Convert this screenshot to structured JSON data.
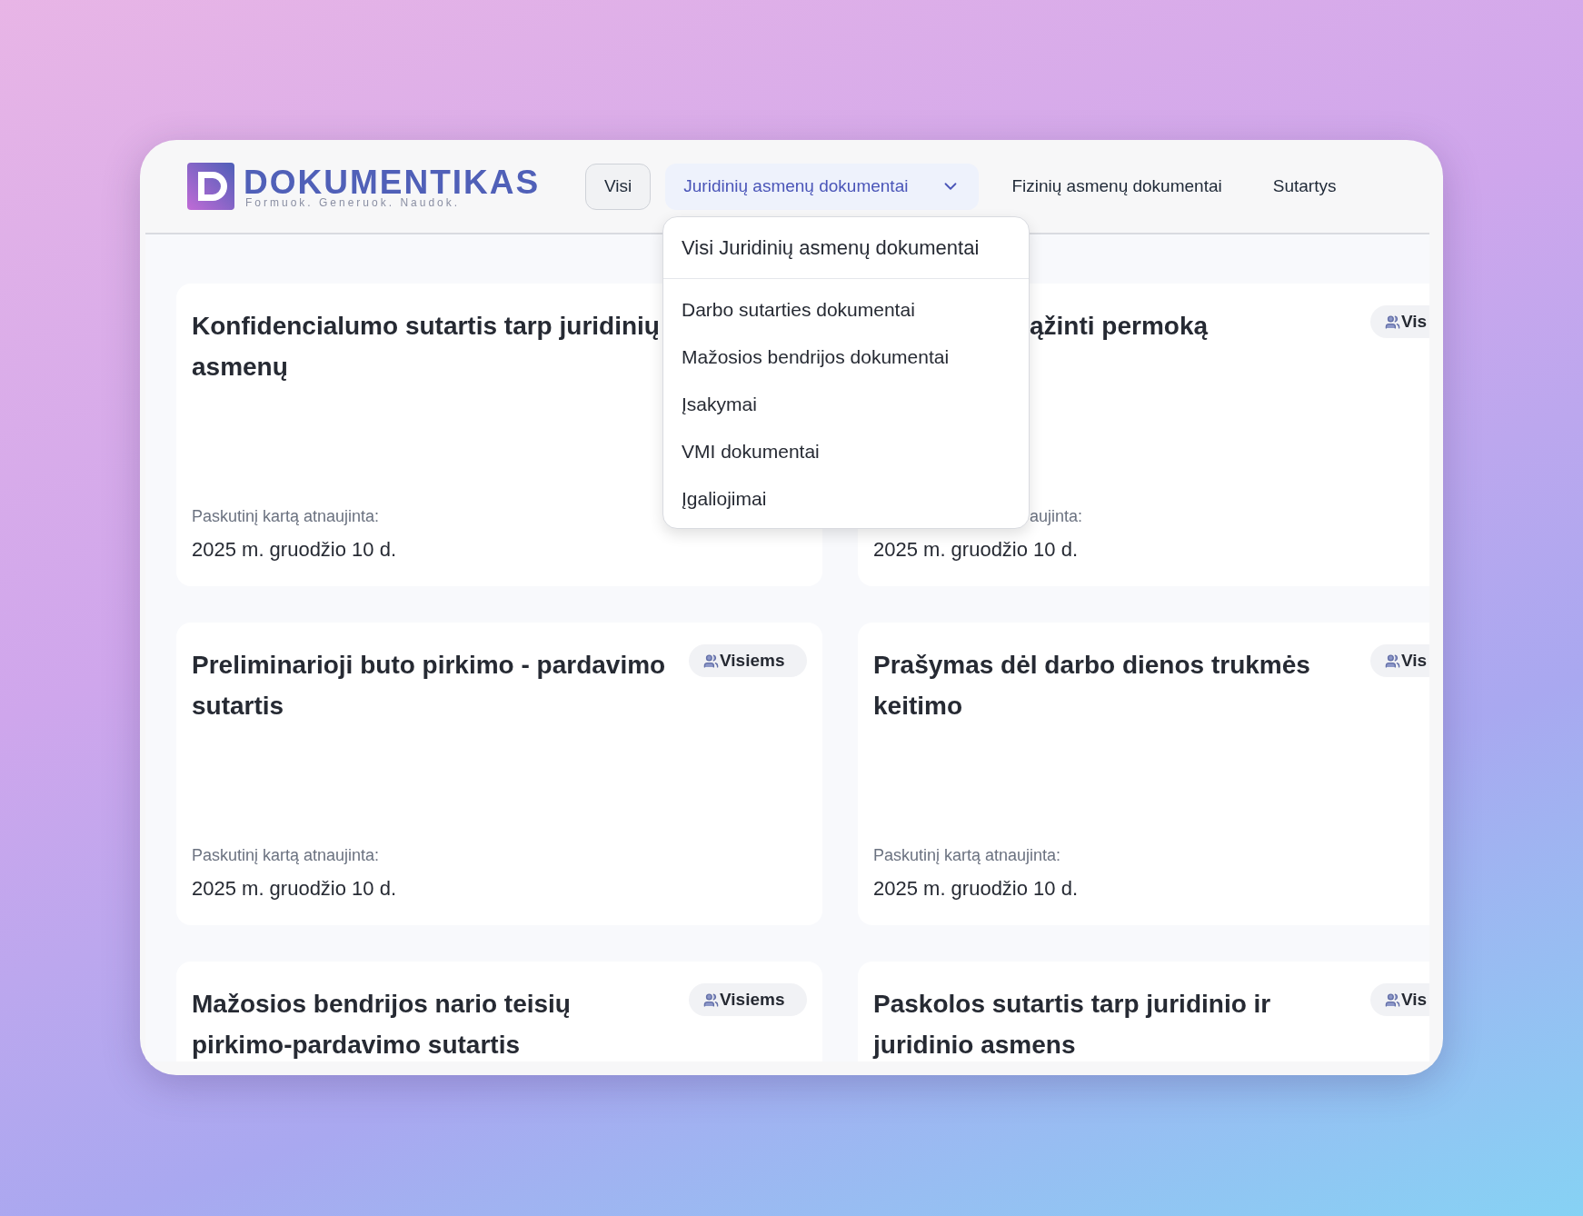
{
  "logo": {
    "name": "DOKUMENTIKAS",
    "tagline": "Formuok. Generuok. Naudok."
  },
  "nav": [
    {
      "label": "Visi",
      "kind": "button",
      "selected": false
    },
    {
      "label": "Juridinių asmenų dokumentai",
      "kind": "dropdown",
      "selected": true,
      "expanded": true
    },
    {
      "label": "Fizinių asmenų dokumentai",
      "kind": "link",
      "selected": false
    },
    {
      "label": "Sutartys",
      "kind": "link",
      "selected": false
    }
  ],
  "dropdown": {
    "items": [
      {
        "label": "Visi Juridinių asmenų dokumentai",
        "kind": "header"
      },
      {
        "label": "Darbo sutarties dokumentai",
        "kind": "item"
      },
      {
        "label": "Mažosios bendrijos dokumentai",
        "kind": "item"
      },
      {
        "label": "Įsakymai",
        "kind": "item"
      },
      {
        "label": "VMI dokumentai",
        "kind": "item"
      },
      {
        "label": "Įgaliojimai",
        "kind": "item"
      }
    ]
  },
  "cards": [
    {
      "title": "Konfidencialumo sutartis tarp juridinių asmenų",
      "covered": false,
      "updated_label": "Paskutinį kartą atnaujinta:",
      "updated": "2025 m. gruodžio 10 d."
    },
    {
      "title": "ąžinti permoką",
      "covered": true,
      "badge": "Vis",
      "updated_label": "aujinta:",
      "updated": "2025 m. gruodžio 10 d."
    },
    {
      "title": "Preliminarioji buto pirkimo - pardavimo sutartis",
      "covered": false,
      "badge": "Visiems",
      "updated_label": "Paskutinį kartą atnaujinta:",
      "updated": "2025 m. gruodžio 10 d."
    },
    {
      "title": "Prašymas dėl darbo dienos trukmės keitimo",
      "covered": false,
      "badge": "Vis",
      "updated_label": "Paskutinį kartą atnaujinta:",
      "updated": "2025 m. gruodžio 10 d."
    },
    {
      "title": "Mažosios bendrijos nario teisių pirkimo-pardavimo sutartis",
      "covered": false,
      "badge": "Visiems"
    },
    {
      "title": "Paskolos sutartis tarp juridinio ir juridinio asmens",
      "covered": false,
      "badge": "Vis"
    }
  ]
}
